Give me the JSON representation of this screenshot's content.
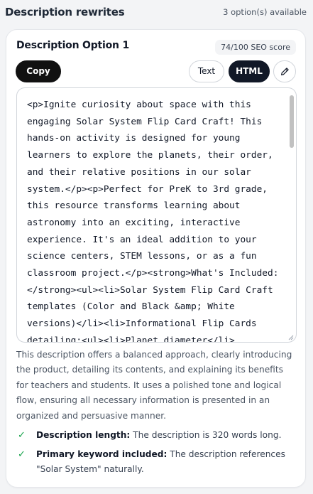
{
  "header": {
    "title": "Description rewrites",
    "count": "3 option(s) available"
  },
  "option": {
    "title": "Description Option 1",
    "seo_score": "74/100 SEO score",
    "copy_label": "Copy",
    "text_label": "Text",
    "html_label": "HTML",
    "active_format": "HTML",
    "icons": {
      "edit": "pencil-icon",
      "check": "check-icon"
    },
    "html_content": "<p>Ignite curiosity about space with this engaging Solar System Flip Card Craft! This hands-on activity is designed for young learners to explore the planets, their order, and their relative positions in our solar system.</p><p>Perfect for PreK to 3rd grade, this resource transforms learning about astronomy into an exciting, interactive experience. It's an ideal addition to your science centers, STEM lessons, or as a fun classroom project.</p><strong>What's Included:</strong><ul><li>Solar System Flip Card Craft templates (Color and Black &amp; White versions)</li><li>Informational Flip Cards detailing:<ul><li>Planet diameter</li>",
    "summary": "This description offers a balanced approach, clearly introducing the product, detailing its contents, and explaining its benefits for teachers and students. It uses a polished tone and logical flow, ensuring all necessary information is presented in an organized and persuasive manner.",
    "checks": [
      {
        "label": "Description length:",
        "text": "The description is 320 words long."
      },
      {
        "label": "Primary keyword included:",
        "text": "The description references \"Solar System\" naturally."
      }
    ]
  },
  "colors": {
    "page_bg": "#f3f4f6",
    "primary": "#111827",
    "check": "#16a34a",
    "muted": "#4b5563"
  }
}
